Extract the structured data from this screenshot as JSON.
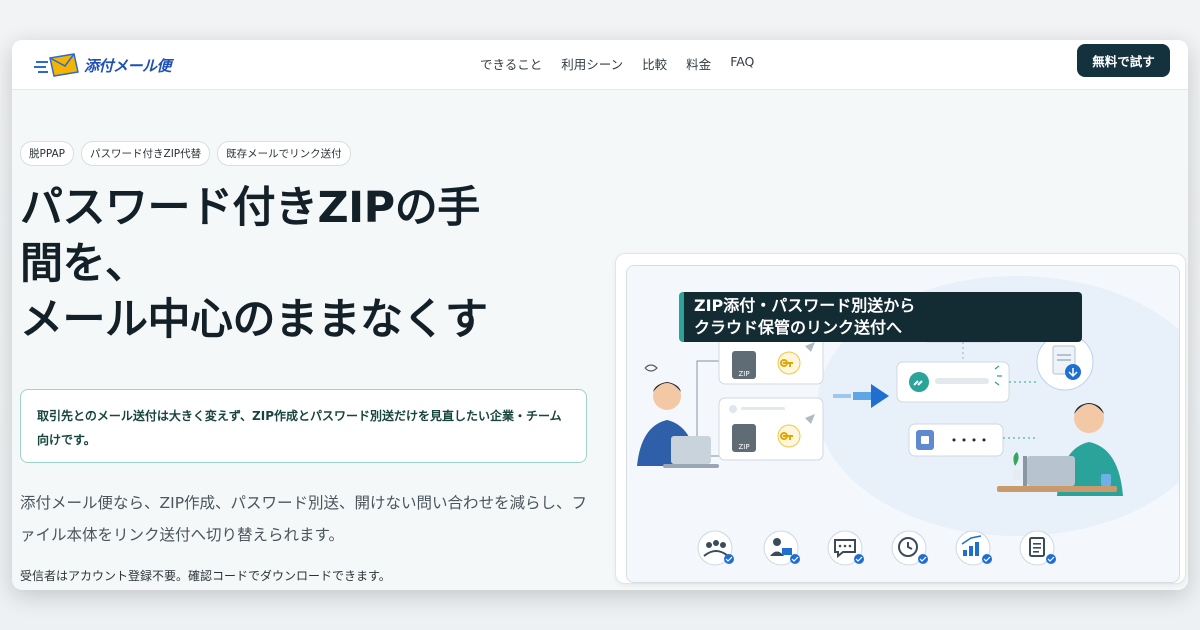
{
  "brand": {
    "name": "添付メール便"
  },
  "nav": {
    "items": [
      "できること",
      "利用シーン",
      "比較",
      "料金",
      "FAQ"
    ]
  },
  "cta": {
    "label": "無料で試す"
  },
  "tags": [
    "脱PPAP",
    "パスワード付きZIP代替",
    "既存メールでリンク送付"
  ],
  "hero": {
    "headline": [
      "パスワード付きZIPの手",
      "間を、",
      "メール中心のままなくす"
    ],
    "notice": "取引先とのメール送付は大きく変えず、ZIP作成とパスワード別送だけを見直したい企業・チーム向けです。",
    "description": "添付メール便なら、ZIP作成、パスワード別送、開けない問い合わせを減らし、ファイル本体をリンク送付へ切り替えられます。",
    "note": "受信者はアカウント登録不要。確認コードでダウンロードできます。"
  },
  "illustration": {
    "caption": [
      "ZIP添付・パスワード別送から",
      "クラウド保管のリンク送付へ"
    ],
    "zip_label": "ZIP",
    "code_mask": "• • • •",
    "feature_icons": [
      "team-icon",
      "user-laptop-icon",
      "chat-icon",
      "clock-icon",
      "bar-chart-icon",
      "document-icon"
    ],
    "accent": "#1f6fd1",
    "brand_dark": "#13323d",
    "teal": "#2aa39a"
  }
}
